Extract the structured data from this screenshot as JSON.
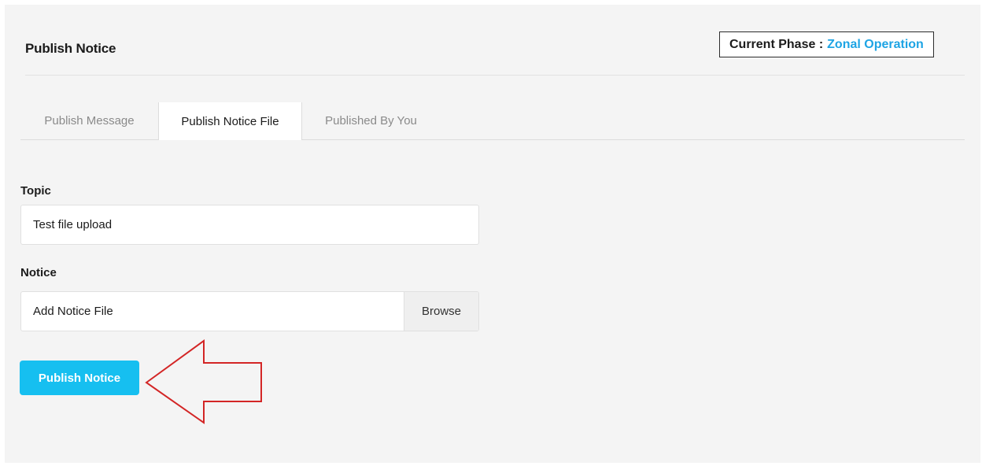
{
  "header": {
    "title": "Publish Notice",
    "phase_label": "Current Phase :",
    "phase_value": "Zonal Operation",
    "phase_color": "#1ea4e4"
  },
  "tabs": [
    {
      "label": "Publish Message",
      "active": false
    },
    {
      "label": "Publish Notice File",
      "active": true
    },
    {
      "label": "Published By You",
      "active": false
    }
  ],
  "form": {
    "topic_label": "Topic",
    "topic_value": "Test file upload",
    "notice_label": "Notice",
    "notice_file_placeholder": "Add Notice File",
    "browse_label": "Browse",
    "submit_label": "Publish Notice",
    "submit_color": "#16bff0"
  },
  "annotation": {
    "icon": "left-arrow-outline-icon",
    "color": "#d32525"
  }
}
